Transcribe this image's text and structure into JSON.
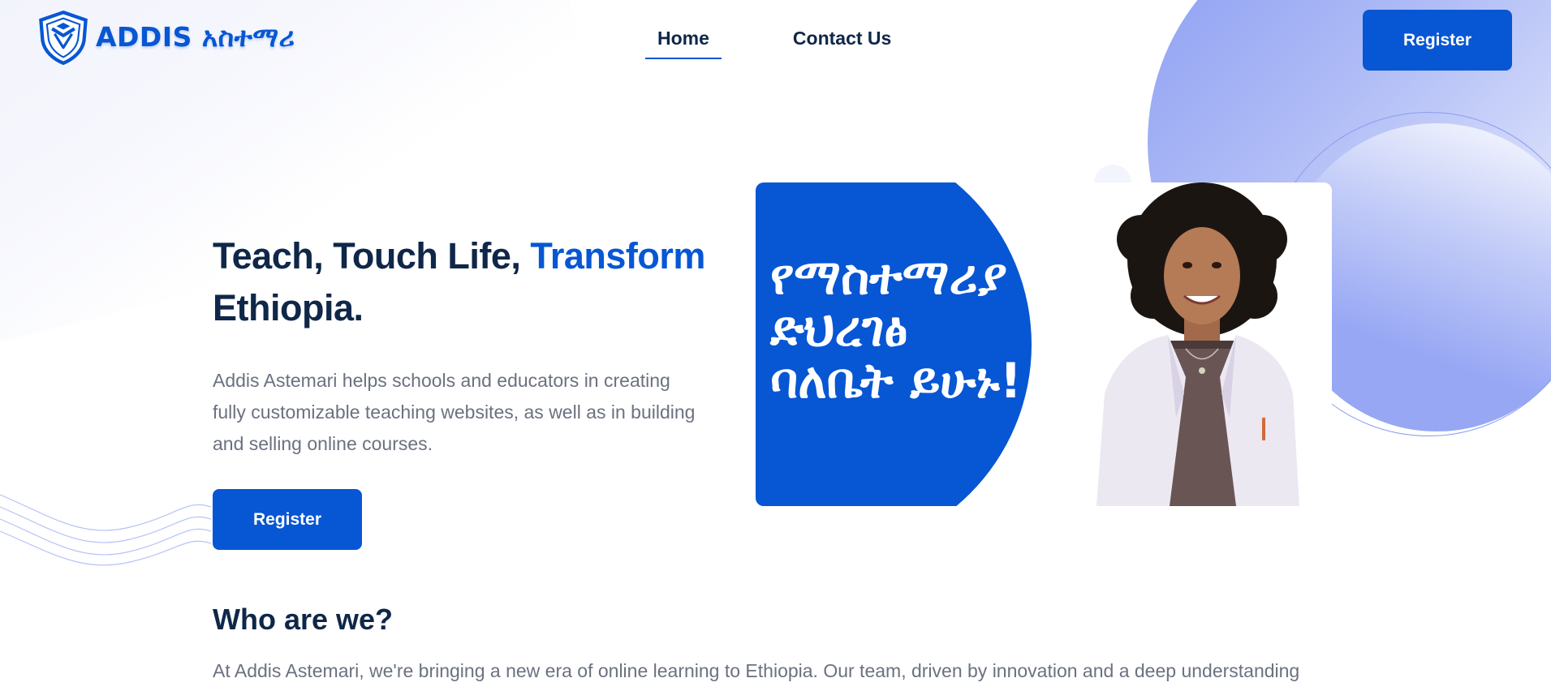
{
  "header": {
    "logo_text": "ADDIS አስተማሪ",
    "nav": [
      {
        "label": "Home",
        "active": true
      },
      {
        "label": "Contact Us",
        "active": false
      }
    ],
    "register_label": "Register"
  },
  "hero": {
    "title_part1": "Teach, Touch Life, ",
    "title_accent": "Transform",
    "title_part2": "Ethiopia.",
    "description": "Addis Astemari helps schools and educators in creating fully customizable teaching websites, as well as in building and selling online courses.",
    "register_label": "Register",
    "banner_lines": [
      "የማስተማሪያ",
      "ድህረገፅ",
      "ባለቤት ይሁኑ!"
    ]
  },
  "about": {
    "title": "Who are we?",
    "text": "At Addis Astemari, we're bringing a new era of online learning to Ethiopia. Our team, driven by innovation and a deep understanding"
  },
  "colors": {
    "primary": "#0756d4",
    "heading": "#0f2748",
    "body_text": "#6b7180",
    "decor_lavender": "#8a9cf2"
  }
}
